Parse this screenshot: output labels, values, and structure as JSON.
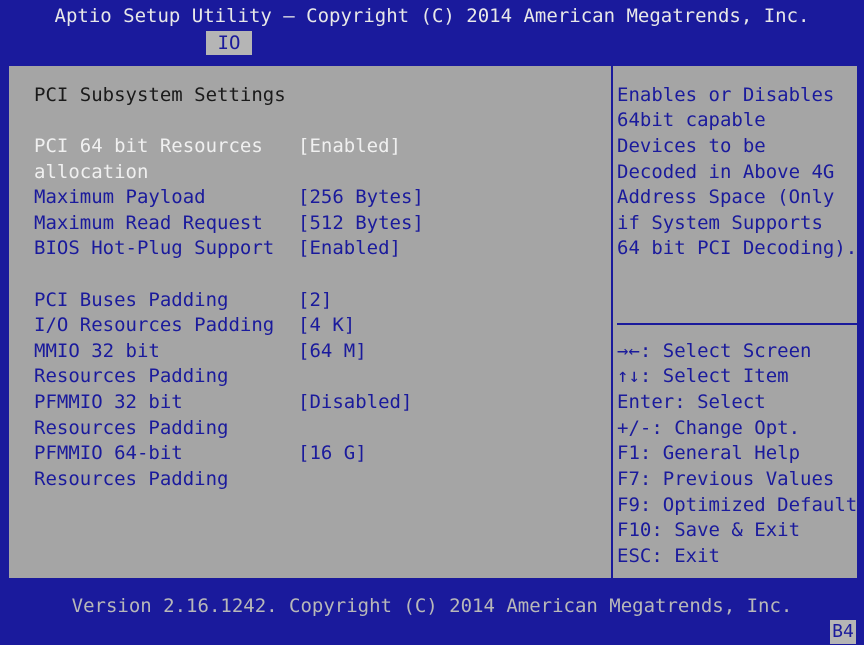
{
  "header": {
    "title": "Aptio Setup Utility – Copyright (C) 2014 American Megatrends, Inc."
  },
  "tabs": [
    {
      "label": "IO",
      "selected": true
    }
  ],
  "main": {
    "section_title": "PCI Subsystem Settings",
    "items": [
      {
        "label_lines": [
          "PCI 64 bit Resources",
          "allocation"
        ],
        "value": "[Enabled]",
        "selected": true
      },
      {
        "label_lines": [
          "Maximum Payload"
        ],
        "value": "[256 Bytes]"
      },
      {
        "label_lines": [
          "Maximum Read Request"
        ],
        "value": "[512 Bytes]"
      },
      {
        "label_lines": [
          "BIOS Hot-Plug Support"
        ],
        "value": "[Enabled]"
      },
      {
        "label_lines": [
          "PCI Buses Padding"
        ],
        "value": "[2]"
      },
      {
        "label_lines": [
          "I/O Resources Padding"
        ],
        "value": "[4 K]"
      },
      {
        "label_lines": [
          "MMIO 32 bit",
          "Resources Padding"
        ],
        "value": "[64 M]"
      },
      {
        "label_lines": [
          "PFMMIO 32 bit",
          "Resources Padding"
        ],
        "value": "[Disabled]"
      },
      {
        "label_lines": [
          "PFMMIO 64-bit",
          "Resources Padding"
        ],
        "value": "[16 G]"
      }
    ]
  },
  "help": {
    "lines": [
      "Enables or Disables",
      "64bit capable",
      "Devices to be",
      "Decoded in Above 4G",
      "Address Space (Only",
      "if System Supports",
      "64 bit PCI Decoding)."
    ]
  },
  "keys": [
    {
      "key": "→←",
      "desc": ": Select Screen"
    },
    {
      "key": "↑↓",
      "desc": ": Select Item"
    },
    {
      "key": "Enter",
      "desc": ": Select"
    },
    {
      "key": "+/-",
      "desc": ": Change Opt."
    },
    {
      "key": "F1",
      "desc": ": General Help"
    },
    {
      "key": "F7",
      "desc": ": Previous Values"
    },
    {
      "key": "F9",
      "desc": ": Optimized Defaults"
    },
    {
      "key": "F10",
      "desc": ": Save & Exit"
    },
    {
      "key": "ESC",
      "desc": ": Exit"
    }
  ],
  "footer": {
    "version": "Version 2.16.1242. Copyright (C) 2014 American Megatrends, Inc."
  },
  "badge": "B4",
  "colors": {
    "background": "#1a1a9c",
    "panel": "#a5a5a5",
    "text_blue": "#1a1a9c",
    "highlight": "#f0f0f0"
  }
}
